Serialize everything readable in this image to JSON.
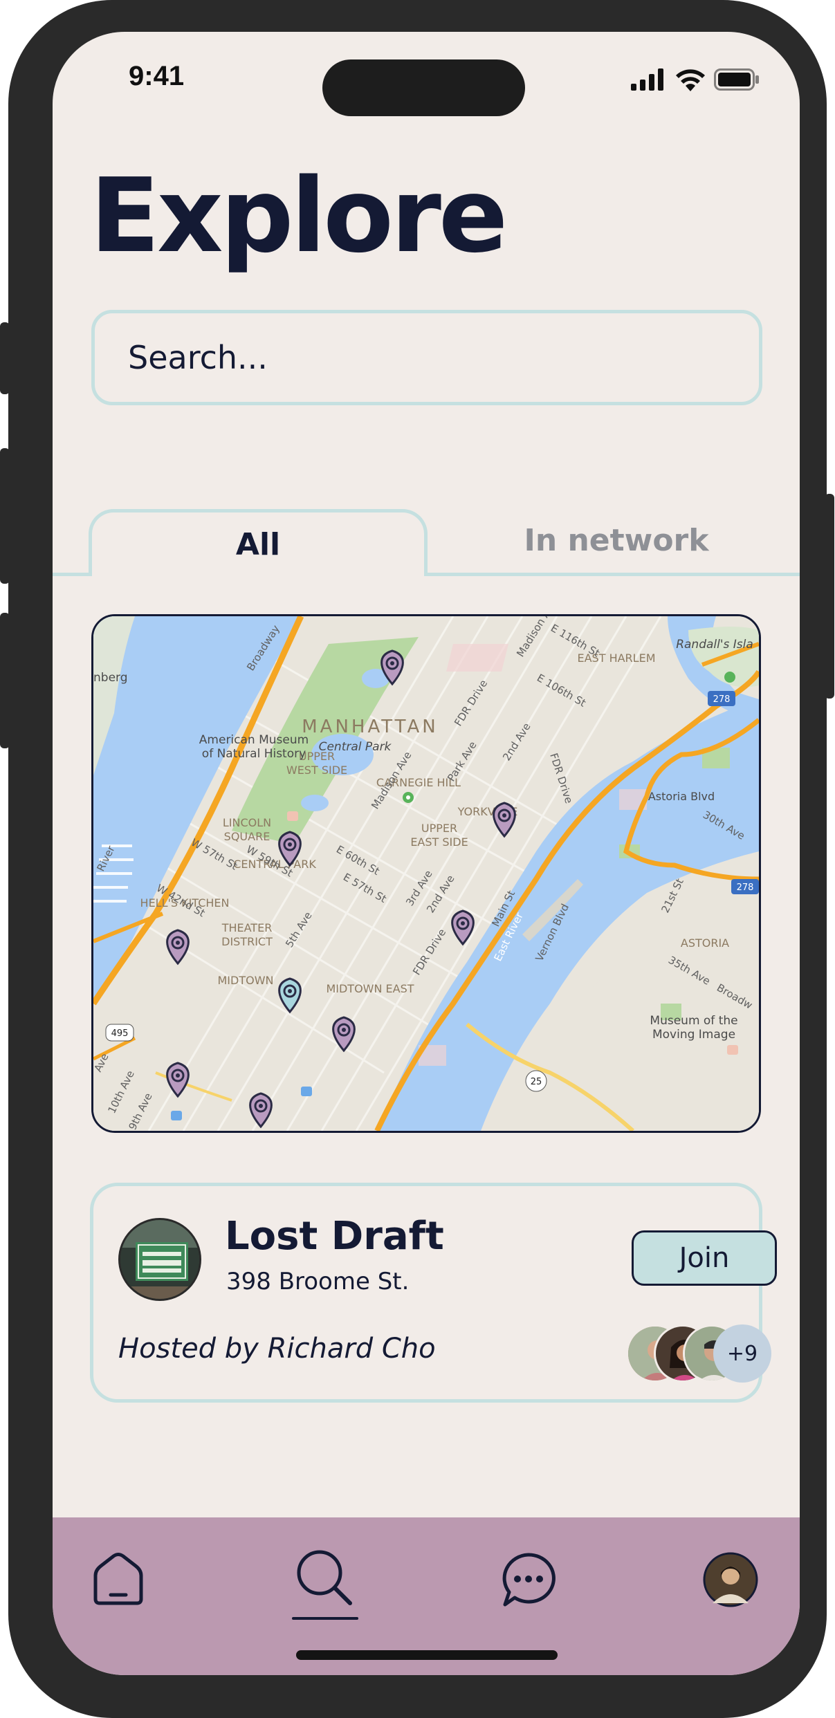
{
  "status_bar": {
    "time": "9:41"
  },
  "page": {
    "title": "Explore"
  },
  "search": {
    "placeholder": "Search..."
  },
  "tabs": [
    {
      "label": "All",
      "active": true
    },
    {
      "label": "In network",
      "active": false
    }
  ],
  "map": {
    "labels": {
      "manhattan": "MANHATTAN",
      "upper_west_side_1": "UPPER",
      "upper_west_side_2": "WEST SIDE",
      "museum_1": "American Museum",
      "museum_2": "of Natural History",
      "central_park": "Central Park",
      "carnegie_hill": "CARNEGIE HILL",
      "lincoln_square_1": "LINCOLN",
      "lincoln_square_2": "SQUARE",
      "central_park_south": "CENTRAL PARK",
      "yorkville": "YORKVILLE",
      "upper_east_side_1": "UPPER",
      "upper_east_side_2": "EAST SIDE",
      "hells_kitchen": "HELL'S KITCHEN",
      "theater_district_1": "THEATER",
      "theater_district_2": "DISTRICT",
      "midtown": "MIDTOWN",
      "midtown_east": "MIDTOWN EAST",
      "east_harlem": "EAST HARLEM",
      "randalls_island": "Randall's Isla",
      "astoria_blvd": "Astoria Blvd",
      "astoria": "ASTORIA",
      "moving_image_1": "Museum of the",
      "moving_image_2": "Moving Image",
      "nberg": "nberg",
      "w57": "W 57th St",
      "w42": "W 42nd St",
      "w59": "W 59th St",
      "e60": "E 60th St",
      "e57": "E 57th St",
      "e106": "E 106th St",
      "e116": "E 116th St",
      "broadway": "Broadway",
      "madison": "Madison Ave",
      "madison_top": "Madison Ave",
      "park_ave": "Park Ave",
      "second_ave": "2nd Ave",
      "third_ave": "3rd Ave",
      "second_ave_2": "2nd Ave",
      "fifth_ave": "5th Ave",
      "fdr_1": "FDR Drive",
      "fdr_2": "FDR Drive",
      "fdr_3": "FDR Drive",
      "east_river": "East River",
      "main_st": "Main St",
      "vernon": "Vernon Blvd",
      "thirtieth": "30th Ave",
      "twentyfirst": "21st St",
      "thirtyfifth": "35th Ave",
      "broadw": "Broadw",
      "tenth_ave": "10th Ave",
      "ninth_ave": "9th Ave",
      "ave": "Ave",
      "river": "River",
      "shield_495": "495",
      "shield_278_top": "278",
      "shield_278_right": "278",
      "shield_25": "25"
    },
    "pin_count": 9
  },
  "event_card": {
    "name": "Lost Draft",
    "address": "398 Broome St.",
    "host": "Hosted by Richard Cho",
    "join_label": "Join",
    "extra_attendees": "+9"
  },
  "colors": {
    "background": "#f2ece8",
    "accent_teal": "#c5e0e0",
    "navy": "#141a34",
    "nav_bar": "#bb99b0",
    "pin": "#b99bc0",
    "pin_selected": "#a9d6de"
  },
  "bottom_nav": [
    {
      "icon": "home-icon",
      "active": false
    },
    {
      "icon": "search-icon",
      "active": true
    },
    {
      "icon": "chat-icon",
      "active": false
    },
    {
      "icon": "profile-avatar",
      "active": false
    }
  ]
}
